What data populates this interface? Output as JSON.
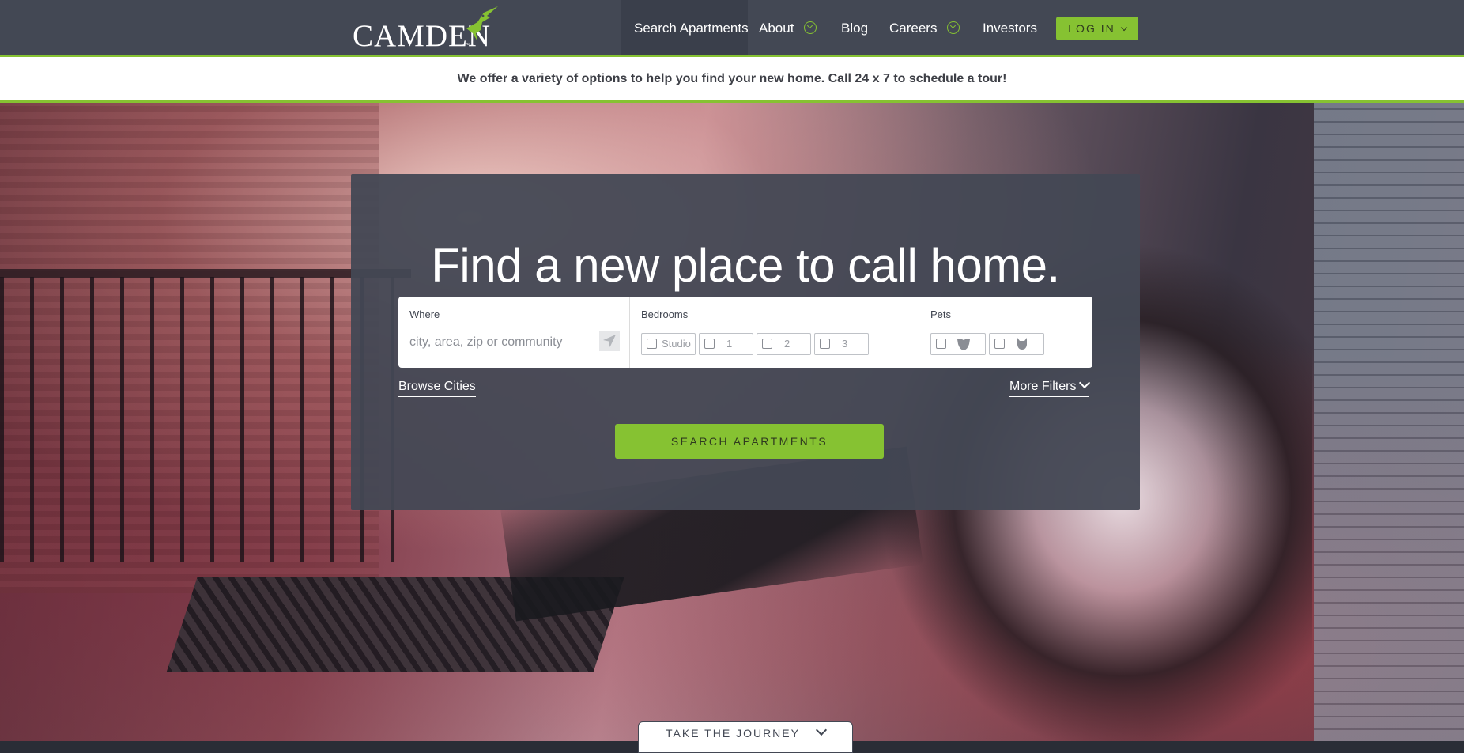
{
  "header": {
    "logo_text": "CAMDEN",
    "logo_tm": "™",
    "nav": [
      {
        "label": "Search Apartments",
        "active": true
      },
      {
        "label": "About",
        "dropdown": true
      },
      {
        "label": "Blog"
      },
      {
        "label": "Careers",
        "dropdown": true
      },
      {
        "label": "Investors"
      }
    ],
    "login_label": "LOG IN"
  },
  "banner": {
    "text": "We offer a variety of options to help you find your new home. Call 24 x 7 to schedule a tour!"
  },
  "search": {
    "headline": "Find a new place to call home.",
    "where_label": "Where",
    "where_placeholder": "city, area, zip or community",
    "bedrooms_label": "Bedrooms",
    "bedroom_options": [
      "Studio",
      "1",
      "2",
      "3"
    ],
    "pets_label": "Pets",
    "pet_options": [
      "dog-icon",
      "cat-icon"
    ],
    "browse_cities": "Browse Cities",
    "more_filters": "More Filters",
    "button_label": "SEARCH APARTMENTS"
  },
  "journey_label": "TAKE THE JOURNEY",
  "colors": {
    "accent": "#86c232",
    "nav_bg": "#434854",
    "panel_bg": "#434854"
  }
}
